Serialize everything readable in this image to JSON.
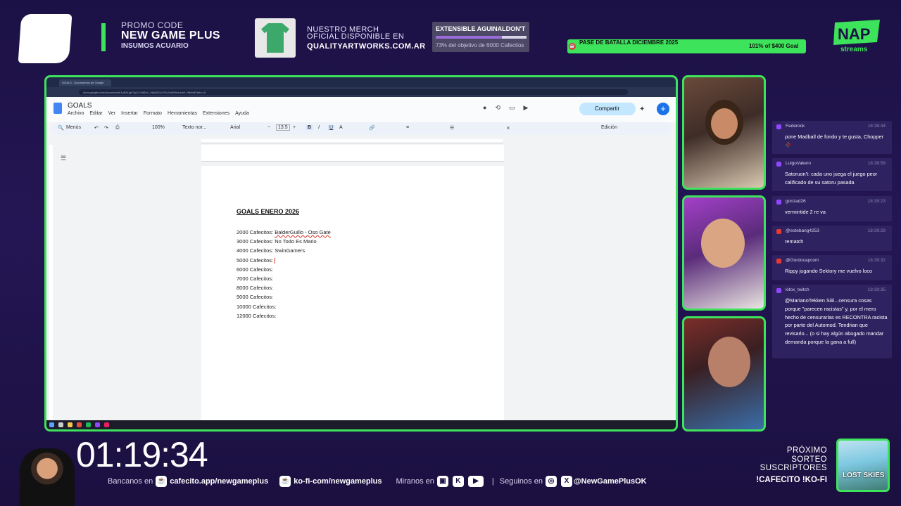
{
  "top": {
    "promo_label": "PROMO CODE",
    "promo_code": "NEW GAME PLUS",
    "promo_sub": "INSUMOS ACUARIO",
    "merch_line1": "NUESTRO MERCH",
    "merch_line2": "OFICIAL DISPONIBLE EN",
    "merch_url": "QUALITYARTWORKS.COM.AR",
    "goal_title": "EXTENSIBLE AGUINALDON'T",
    "goal_progress": 0.73,
    "goal_text": "73% del objetivo de 6000 Cafecitos",
    "pass_title": "PASE DE BATALLA DICIEMBRE 2025",
    "pass_goal": "101% of $400 Goal",
    "brand_logo": "NAP streams"
  },
  "browser": {
    "tab_title": "GOALS - Documentos de Google",
    "url": "docs.google.com/document/d/1yBAUgCVpO-0d6Drv_VkhQGU24Tu2eWr5hsuhe9-2M/edit?tab=t.0"
  },
  "docs": {
    "title": "GOALS",
    "menu": [
      "Archivo",
      "Editar",
      "Ver",
      "Insertar",
      "Formato",
      "Herramientas",
      "Extensiones",
      "Ayuda"
    ],
    "share_label": "Compartir",
    "menus_label": "Menús",
    "zoom": "100%",
    "style": "Texto nor...",
    "font": "Arial",
    "font_size": "13.5",
    "mode": "Edición"
  },
  "document": {
    "heading": "GOALS ENERO 2026",
    "lines": [
      {
        "amount": "2000 Cafecitos:",
        "goal": "BalderGuillo - Oso Gate"
      },
      {
        "amount": "3000 Cafecitos:",
        "goal": "No Todo Es Mario"
      },
      {
        "amount": "4000 Cafecitos:",
        "goal": "SwinGamers"
      },
      {
        "amount": "5000 Cafecitos:",
        "goal": ""
      },
      {
        "amount": "6000 Cafecitos:",
        "goal": ""
      },
      {
        "amount": "7000 Cafecitos:",
        "goal": ""
      },
      {
        "amount": "8000 Cafecitos:",
        "goal": ""
      },
      {
        "amount": "9000 Cafecitos:",
        "goal": ""
      },
      {
        "amount": "10000 Cafecitos:",
        "goal": ""
      },
      {
        "amount": "12000 Cafecitos:",
        "goal": ""
      }
    ]
  },
  "chat": {
    "messages": [
      {
        "user": "Federock",
        "time": "18:38:44",
        "text": "pone Madball de fondo y te gusta, Chopper 🥀",
        "platform": "twitch"
      },
      {
        "user": "LuigoVakero",
        "time": "18:38:59",
        "text": "Satoruon't: cada uno juega el juego peor calificado de su satoru pasada",
        "platform": "twitch"
      },
      {
        "user": "gonzad26",
        "time": "18:39:23",
        "text": "vermintide 2 re va",
        "platform": "twitch"
      },
      {
        "user": "@estebang4253",
        "time": "18:39:29",
        "text": "rematch",
        "platform": "youtube"
      },
      {
        "user": "@Gordocapcom",
        "time": "18:39:32",
        "text": "Rippy jugando Sektory me vuelvo loco",
        "platform": "youtube"
      },
      {
        "user": "kitox_twitch",
        "time": "18:39:35",
        "text": "@MarianoTekken Siiii...censura cosas porque \"parecen racistas\" y, por el mero hecho de censurarlas es RECONTRA racista por parte del Automod. Tendrian que revisarlo... (o si hay algún abogado mandar demanda porque la gana a full)",
        "platform": "twitch"
      }
    ]
  },
  "bottom": {
    "timer": "01:19:34",
    "bancanos_label": "Bancanos en",
    "cafecito_url": "cafecito.app/newgameplus",
    "kofi_url": "ko-fi-com/newgameplus",
    "miranos_label": "Miranos en",
    "seguinos_label": "Seguinos en",
    "handle": "@NewGamePlusOK",
    "sorteo_line1": "PRÓXIMO",
    "sorteo_line2": "SORTEO",
    "sorteo_line3": "SUSCRIPTORES",
    "sorteo_cmd": "!CAFECITO !KO-FI",
    "game_title": "LOST SKIES"
  },
  "colors": {
    "accent": "#3de35a",
    "background": "#1c1145",
    "chat_bubble": "#2e2260"
  }
}
